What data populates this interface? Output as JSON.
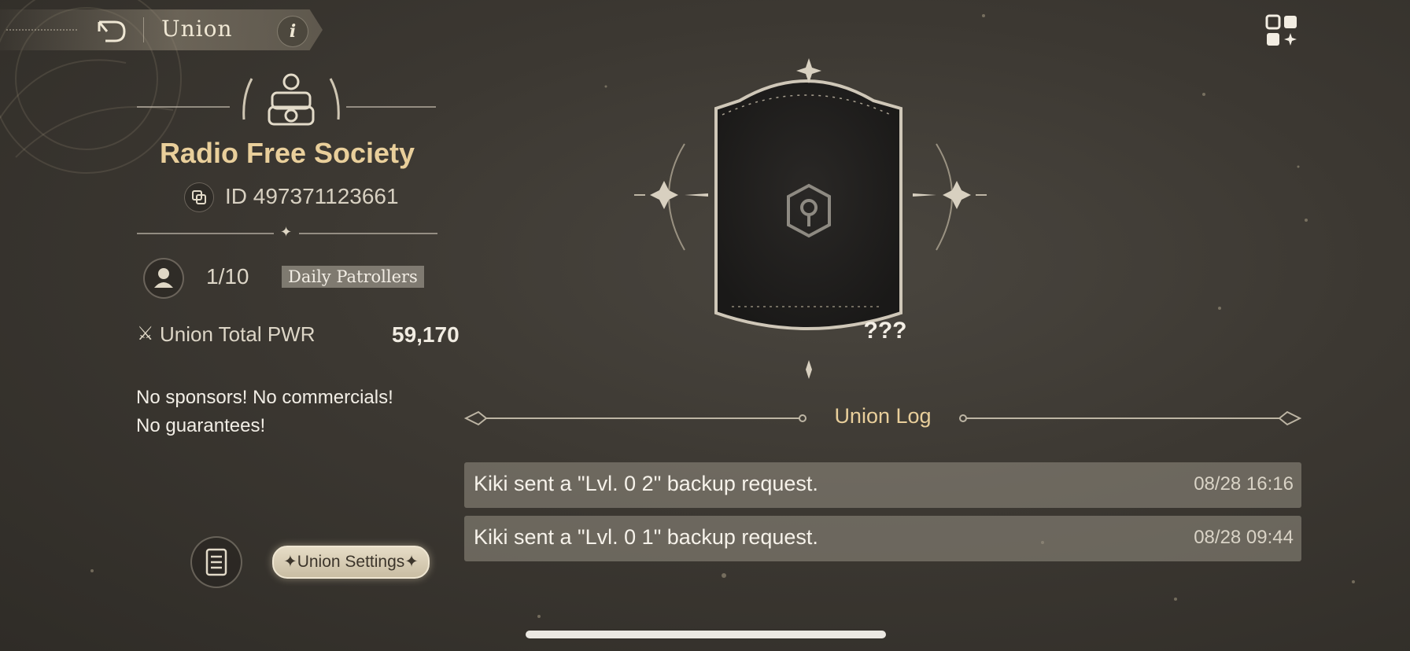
{
  "header": {
    "title": "Union"
  },
  "union": {
    "name": "Radio Free Society",
    "id": "ID 497371123661",
    "members": "1/10",
    "activity_tag": "Daily Patrollers",
    "pwr_label": "Union Total PWR",
    "pwr_value": "59,170",
    "description_line1": "No sponsors! No commercials!",
    "description_line2": "No guarantees!"
  },
  "buttons": {
    "settings_label": "✦Union Settings✦"
  },
  "emblem": {
    "label": "???"
  },
  "log": {
    "title": "Union Log",
    "entries": [
      {
        "message": "Kiki sent a \"Lvl. 0 2\" backup request.",
        "time": "08/28 16:16"
      },
      {
        "message": "Kiki sent a \"Lvl. 0 1\" backup request.",
        "time": "08/28 09:44"
      }
    ]
  },
  "colors": {
    "accent_gold": "#e9cf9b",
    "background": "#3c3832",
    "log_row": "#969084"
  },
  "icons": [
    "back-icon",
    "info-icon",
    "grid-menu-icon",
    "union-crest-icon",
    "copy-icon",
    "member-icon",
    "crossed-swords-icon",
    "notes-icon",
    "lock-emblem-icon"
  ]
}
